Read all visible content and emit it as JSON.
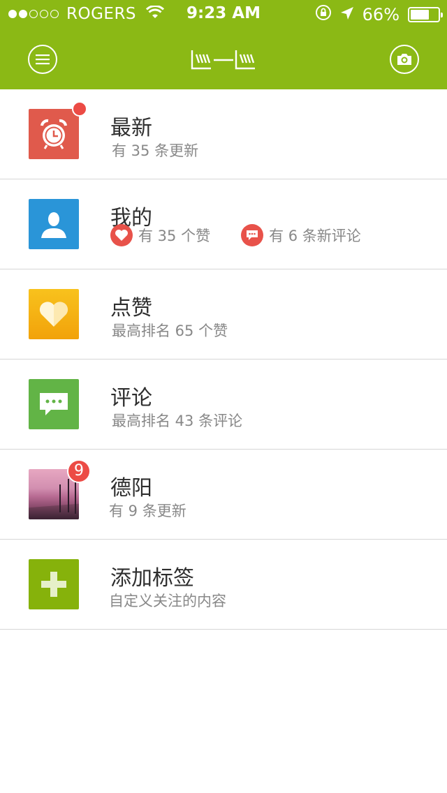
{
  "status_bar": {
    "carrier": "ROGERS",
    "time": "9:23 AM",
    "battery": "66%",
    "battery_level": 0.66,
    "signal_bars_filled": 2,
    "signal_bars_total": 5
  },
  "header": {
    "menu_icon": "menu-icon",
    "logo_icon": "logo-icon",
    "camera_icon": "camera-icon"
  },
  "colors": {
    "brand_green": "#8bb915",
    "red": "#ec4b45",
    "blue": "#2a95d8",
    "yellow": "#f5b414",
    "green": "#62b446",
    "lime": "#86b20b",
    "coral": "#e05a4c"
  },
  "list": {
    "items": [
      {
        "title": "最新",
        "subtitle": "有 35 条更新",
        "icon": "alarm-clock-icon"
      },
      {
        "title": "我的",
        "likes": "有 35 个赞",
        "comments": "有 6 条新评论",
        "icon": "user-icon"
      },
      {
        "title": "点赞",
        "subtitle": "最高排名 65 个赞",
        "icon": "heart-icon"
      },
      {
        "title": "评论",
        "subtitle": "最高排名 43 条评论",
        "icon": "speech-bubble-icon"
      },
      {
        "title": "德阳",
        "subtitle": "有 9 条更新",
        "badge": "9",
        "icon": "photo-thumbnail"
      },
      {
        "title": "添加标签",
        "subtitle": "自定义关注的内容",
        "icon": "plus-icon"
      }
    ]
  }
}
